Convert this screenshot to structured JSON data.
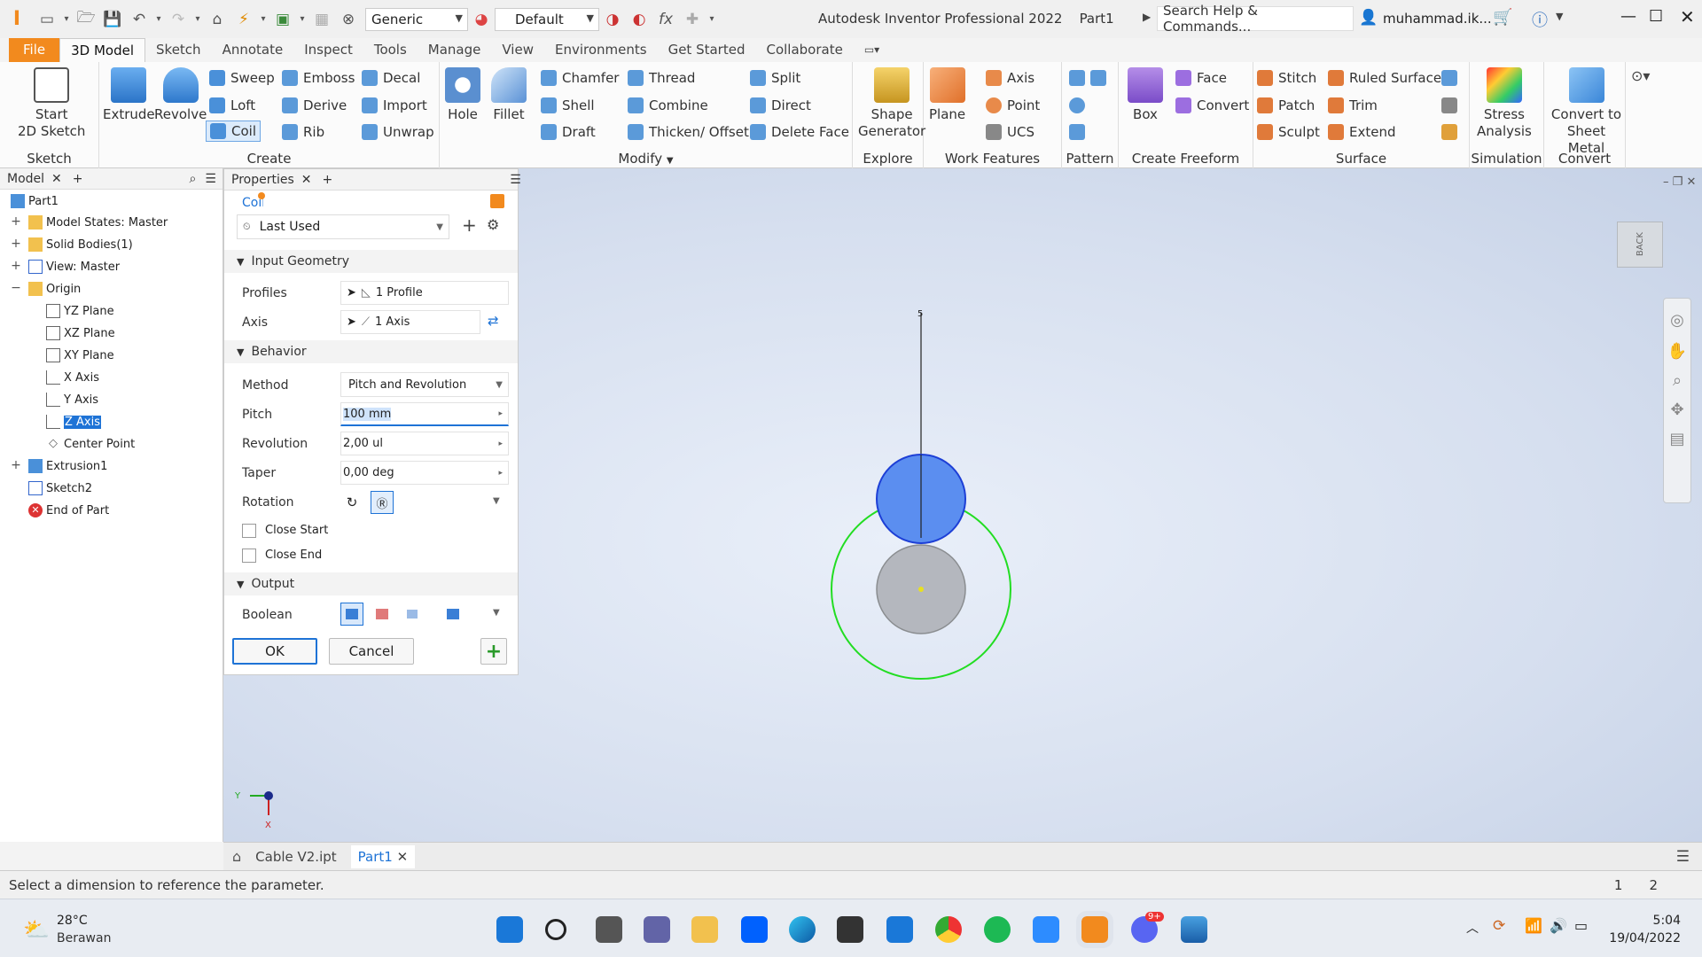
{
  "window": {
    "app_title": "Autodesk Inventor Professional 2022",
    "doc_title": "Part1",
    "search_placeholder": "Search Help & Commands...",
    "user": "muhammad.ik...",
    "material": "Generic",
    "appearance": "Default"
  },
  "ribbon_tabs": [
    "File",
    "3D Model",
    "Sketch",
    "Annotate",
    "Inspect",
    "Tools",
    "Manage",
    "View",
    "Environments",
    "Get Started",
    "Collaborate"
  ],
  "ribbon": {
    "sketch": {
      "label": "Sketch",
      "start": "Start",
      "start2": "2D Sketch"
    },
    "create": {
      "label": "Create",
      "extrude": "Extrude",
      "revolve": "Revolve",
      "sweep": "Sweep",
      "loft": "Loft",
      "coil": "Coil",
      "emboss": "Emboss",
      "derive": "Derive",
      "rib": "Rib",
      "decal": "Decal",
      "import": "Import",
      "unwrap": "Unwrap"
    },
    "modify": {
      "label": "Modify",
      "hole": "Hole",
      "fillet": "Fillet",
      "chamfer": "Chamfer",
      "shell": "Shell",
      "draft": "Draft",
      "thread": "Thread",
      "combine": "Combine",
      "thicken": "Thicken/ Offset",
      "split": "Split",
      "direct": "Direct",
      "delete_face": "Delete Face"
    },
    "explore": {
      "label": "Explore",
      "shape": "Shape",
      "generator": "Generator"
    },
    "work": {
      "label": "Work Features",
      "plane": "Plane",
      "axis": "Axis",
      "point": "Point",
      "ucs": "UCS"
    },
    "pattern": {
      "label": "Pattern"
    },
    "freeform": {
      "label": "Create Freeform",
      "box": "Box",
      "face": "Face",
      "convert": "Convert"
    },
    "surface": {
      "label": "Surface",
      "stitch": "Stitch",
      "patch": "Patch",
      "sculpt": "Sculpt",
      "ruled": "Ruled Surface",
      "trim": "Trim",
      "extend": "Extend"
    },
    "simulation": {
      "label": "Simulation",
      "stress": "Stress",
      "analysis": "Analysis"
    },
    "convert": {
      "label": "Convert",
      "c1": "Convert to",
      "c2": "Sheet Metal"
    }
  },
  "model_panel": {
    "tab": "Model",
    "items": [
      "Part1",
      "Model States: Master",
      "Solid Bodies(1)",
      "View: Master",
      "Origin",
      "YZ Plane",
      "XZ Plane",
      "XY Plane",
      "X Axis",
      "Y Axis",
      "Z Axis",
      "Center Point",
      "Extrusion1",
      "Sketch2",
      "End of Part"
    ]
  },
  "properties": {
    "tab": "Properties",
    "feature": "Coil",
    "preset": "Last Used",
    "input_geometry": "Input Geometry",
    "profiles_label": "Profiles",
    "profiles_value": "1 Profile",
    "axis_label": "Axis",
    "axis_value": "1 Axis",
    "behavior": "Behavior",
    "method_label": "Method",
    "method_value": "Pitch and Revolution",
    "pitch_label": "Pitch",
    "pitch_value": "100 mm",
    "revolution_label": "Revolution",
    "revolution_value": "2,00 ul",
    "taper_label": "Taper",
    "taper_value": "0,00 deg",
    "rotation_label": "Rotation",
    "close_start": "Close Start",
    "close_end": "Close End",
    "output": "Output",
    "boolean_label": "Boolean",
    "ok": "OK",
    "cancel": "Cancel"
  },
  "viewport": {
    "viewcube_label": "BACK",
    "dim_label": "5",
    "triad_y": "Y",
    "triad_x": "X"
  },
  "doc_tabs": [
    "Cable V2.ipt",
    "Part1"
  ],
  "status": {
    "message": "Select a dimension to reference the parameter.",
    "n1": "1",
    "n2": "2"
  },
  "taskbar": {
    "temp": "28°C",
    "weather": "Berawan",
    "time": "5:04",
    "date": "19/04/2022",
    "badge": "9+"
  },
  "colors": {
    "accent_orange": "#f28a1e",
    "selection_blue": "#1e73d6",
    "coil_blue": "#5b8ef0",
    "circle_green": "#22dd22"
  }
}
